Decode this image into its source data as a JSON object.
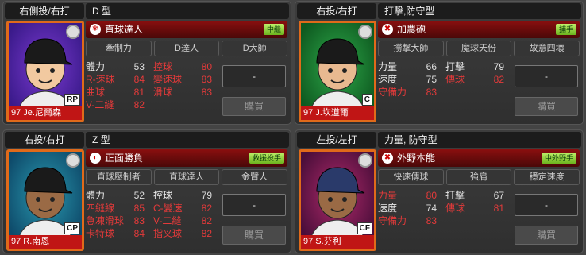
{
  "cards": [
    {
      "pos": "右側投/右打",
      "type": "D 型",
      "name": "97 Je.尼爾森",
      "position_badge": "RP",
      "skill": "直球達人",
      "skill_icon": "❄",
      "tag": "中繼",
      "subs": [
        "牽制力",
        "D達人",
        "D大師"
      ],
      "stats": [
        [
          {
            "l": "體力",
            "v": "53",
            "red": false
          },
          {
            "l": "控球",
            "v": "80",
            "red": true
          }
        ],
        [
          {
            "l": "R-速球",
            "v": "84",
            "red": true
          },
          {
            "l": "變速球",
            "v": "83",
            "red": true
          }
        ],
        [
          {
            "l": "曲球",
            "v": "81",
            "red": true
          },
          {
            "l": "滑球",
            "v": "83",
            "red": true
          }
        ],
        [
          {
            "l": "V-二縫",
            "v": "82",
            "red": true
          }
        ]
      ],
      "dash": "-",
      "buy": "購買",
      "colors": {
        "bg1": "#7a3ad0",
        "bg2": "#3a1a8a",
        "skin": "#f2c9a0",
        "hat": "#1a1a1a"
      }
    },
    {
      "pos": "右投/右打",
      "type": "打擊,防守型",
      "name": "97 J.坎道爾",
      "position_badge": "C",
      "skill": "加農砲",
      "skill_icon": "✖",
      "tag": "捕手",
      "subs": [
        "撈擊大師",
        "魔球天份",
        "故意四壞"
      ],
      "stats": [
        [
          {
            "l": "力量",
            "v": "66",
            "red": false
          },
          {
            "l": "打擊",
            "v": "79",
            "red": false
          }
        ],
        [
          {
            "l": "速度",
            "v": "75",
            "red": false
          },
          {
            "l": "傳球",
            "v": "82",
            "red": true
          }
        ],
        [
          {
            "l": "守備力",
            "v": "83",
            "red": true
          }
        ]
      ],
      "dash": "-",
      "buy": "購買",
      "colors": {
        "bg1": "#2ea84a",
        "bg2": "#0e5a20",
        "skin": "#e8b990",
        "hat": "#1a1a1a"
      }
    },
    {
      "pos": "右投/右打",
      "type": "Z 型",
      "name": "97 R.南恩",
      "position_badge": "CP",
      "skill": "正面勝負",
      "skill_icon": "◐",
      "tag": "救援投手",
      "subs": [
        "直球壓制者",
        "直球達人",
        "金臂人"
      ],
      "stats": [
        [
          {
            "l": "體力",
            "v": "52",
            "red": false
          },
          {
            "l": "控球",
            "v": "79",
            "red": false
          }
        ],
        [
          {
            "l": "四縫線",
            "v": "85",
            "red": true
          },
          {
            "l": "C-變速",
            "v": "82",
            "red": true
          }
        ],
        [
          {
            "l": "急凍滑球",
            "v": "83",
            "red": true
          },
          {
            "l": "V-二縫",
            "v": "82",
            "red": true
          }
        ],
        [
          {
            "l": "卡特球",
            "v": "84",
            "red": true
          },
          {
            "l": "指叉球",
            "v": "82",
            "red": true
          }
        ]
      ],
      "dash": "-",
      "buy": "購買",
      "colors": {
        "bg1": "#2a9ab0",
        "bg2": "#0e4a6a",
        "skin": "#9a6a45",
        "hat": "#1a1a1a"
      }
    },
    {
      "pos": "左投/左打",
      "type": "力量, 防守型",
      "name": "97 S.芬利",
      "position_badge": "CF",
      "skill": "外野本能",
      "skill_icon": "✖",
      "tag": "中外野手",
      "subs": [
        "快速傳球",
        "強肩",
        "穩定速度"
      ],
      "stats": [
        [
          {
            "l": "力量",
            "v": "80",
            "red": true
          },
          {
            "l": "打擊",
            "v": "67",
            "red": false
          }
        ],
        [
          {
            "l": "速度",
            "v": "74",
            "red": false
          },
          {
            "l": "傳球",
            "v": "81",
            "red": true
          }
        ],
        [
          {
            "l": "守備力",
            "v": "83",
            "red": true
          }
        ]
      ],
      "dash": "-",
      "buy": "購買",
      "colors": {
        "bg1": "#b02a6a",
        "bg2": "#4a0e3a",
        "skin": "#9a6a45",
        "hat": "#2a3a6a"
      }
    }
  ]
}
